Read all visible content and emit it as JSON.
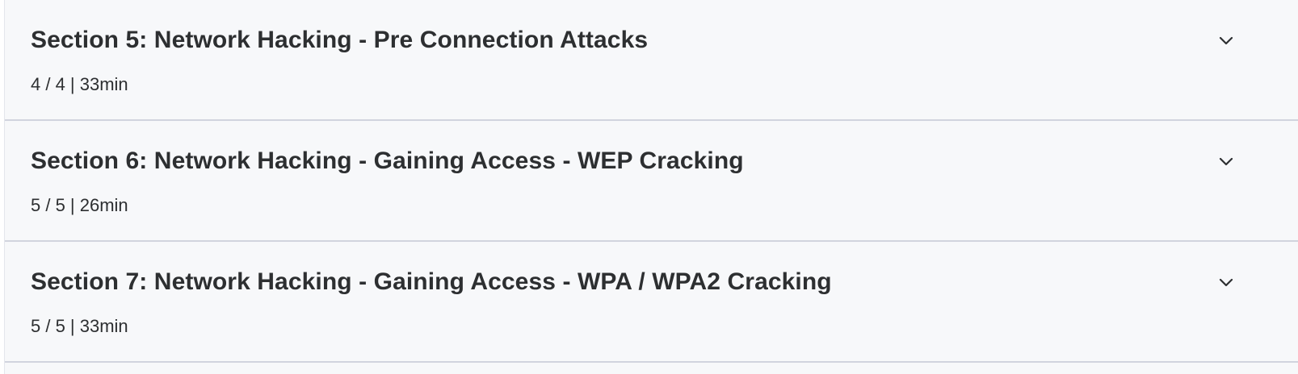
{
  "sections": [
    {
      "title": "Section 5: Network Hacking - Pre Connection Attacks",
      "meta": "4 / 4 | 33min",
      "icon": "chevron-down-icon"
    },
    {
      "title": "Section 6: Network Hacking - Gaining Access - WEP Cracking",
      "meta": "5 / 5 | 26min",
      "icon": "chevron-down-icon"
    },
    {
      "title": "Section 7: Network Hacking - Gaining Access - WPA / WPA2 Cracking",
      "meta": "5 / 5 | 33min",
      "icon": "chevron-down-icon"
    }
  ],
  "colors": {
    "panel_background": "#f7f8fa",
    "text": "#2d2f31",
    "divider": "#d1d4de"
  }
}
